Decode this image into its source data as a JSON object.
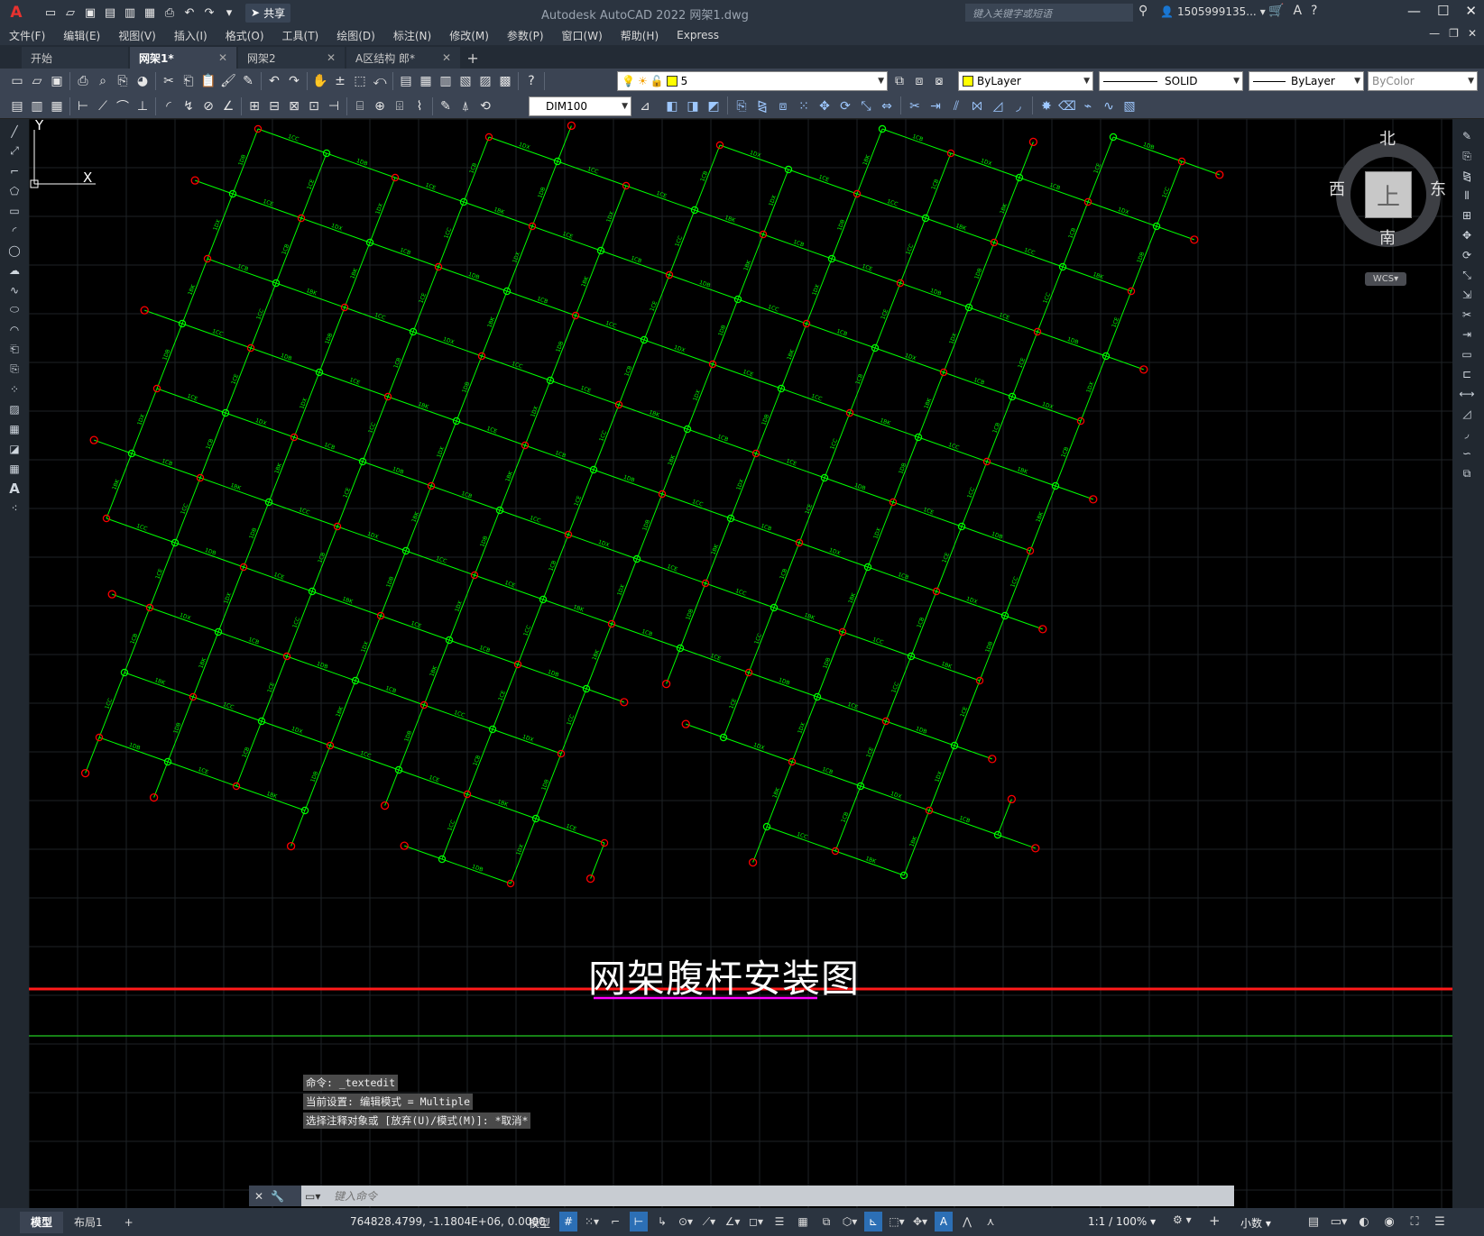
{
  "app": {
    "logo": "A",
    "title": "Autodesk AutoCAD 2022    网架1.dwg",
    "share_label": "共享",
    "search_placeholder": "键入关键字或短语",
    "user": "1505999135...",
    "window_controls": [
      "minimize-icon",
      "maximize-icon",
      "close-icon"
    ]
  },
  "menu": {
    "items": [
      "文件(F)",
      "编辑(E)",
      "视图(V)",
      "插入(I)",
      "格式(O)",
      "工具(T)",
      "绘图(D)",
      "标注(N)",
      "修改(M)",
      "参数(P)",
      "窗口(W)",
      "帮助(H)",
      "Express"
    ]
  },
  "tabs": [
    {
      "label": "开始",
      "active": false,
      "closable": false
    },
    {
      "label": "网架1*",
      "active": true,
      "closable": true
    },
    {
      "label": "网架2",
      "active": false,
      "closable": true
    },
    {
      "label": "A区结构 郎*",
      "active": false,
      "closable": true
    }
  ],
  "toolbar": {
    "layer_value": "5",
    "layer_color": "#ffff00",
    "color_value": "ByLayer",
    "color_swatch": "#ffff00",
    "linetype_value": "SOLID",
    "lineweight_value": "ByLayer",
    "plotstyle_value": "ByColor",
    "dimstyle_value": "DIM100"
  },
  "drawing": {
    "title": "网架腹杆安装图",
    "node_color": "#ff0000",
    "member_color": "#00ff00",
    "title_underline_color": "#ff00ff",
    "grid_color": "#1e2226"
  },
  "viewcube": {
    "north": "北",
    "south": "南",
    "east": "东",
    "west": "西",
    "face": "上",
    "wcs": "WCS"
  },
  "ucs": {
    "x_label": "X",
    "y_label": "Y"
  },
  "command": {
    "history": [
      "命令: _textedit",
      "当前设置: 编辑模式 = Multiple",
      "选择注释对象或 [放弃(U)/模式(M)]: *取消*"
    ],
    "placeholder": "键入命令"
  },
  "status": {
    "model_tab": "模型",
    "layout_tab": "布局1",
    "coords": "764828.4799, -1.1804E+06, 0.0000",
    "model_label": "模型",
    "scale": "1:1 / 100%",
    "units": "小数"
  }
}
